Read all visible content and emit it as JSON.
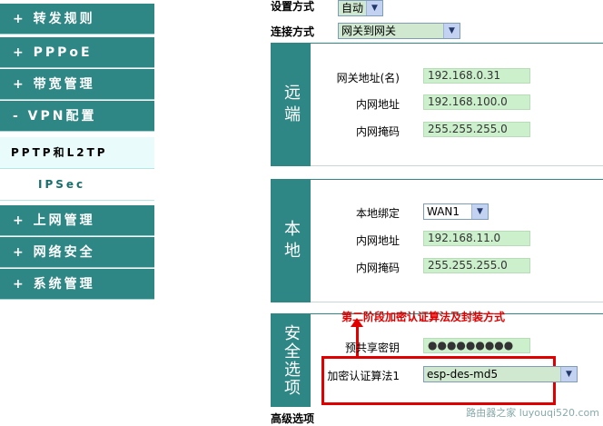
{
  "sidebar": {
    "items": [
      {
        "label": "+ 转发规则"
      },
      {
        "label": "+ PPPoE"
      },
      {
        "label": "+ 带宽管理"
      },
      {
        "label": "- VPN配置"
      },
      {
        "label": "+ 上网管理"
      },
      {
        "label": "+ 网络安全"
      },
      {
        "label": "+ 系统管理"
      }
    ],
    "submenu": [
      {
        "label": "PPTP和L2TP"
      },
      {
        "label": "IPSec"
      }
    ]
  },
  "top": {
    "setup_label": "设置方式",
    "setup_value": "自动",
    "conn_label": "连接方式",
    "conn_value": "网关到网关"
  },
  "remote": {
    "section": "远端",
    "gateway_label": "网关地址(名)",
    "gateway_value": "192.168.0.31",
    "lan_label": "内网地址",
    "lan_value": "192.168.100.0",
    "mask_label": "内网掩码",
    "mask_value": "255.255.255.0"
  },
  "local": {
    "section": "本地",
    "bind_label": "本地绑定",
    "bind_value": "WAN1",
    "lan_label": "内网地址",
    "lan_value": "192.168.11.0",
    "mask_label": "内网掩码",
    "mask_value": "255.255.255.0"
  },
  "security": {
    "section": "安全选项",
    "psk_label": "预共享密钥",
    "psk_value": "●●●●●●●●●",
    "alg_label": "加密认证算法1",
    "alg_value": "esp-des-md5"
  },
  "annotation": "第二阶段加密认证算法及封装方式",
  "footer_label": "高级选项",
  "watermark": "路由器之家 luyouqi520.com",
  "colors": {
    "accent": "#2f8785",
    "annotation": "#e00000",
    "input_bg": "#ccf0cc"
  }
}
